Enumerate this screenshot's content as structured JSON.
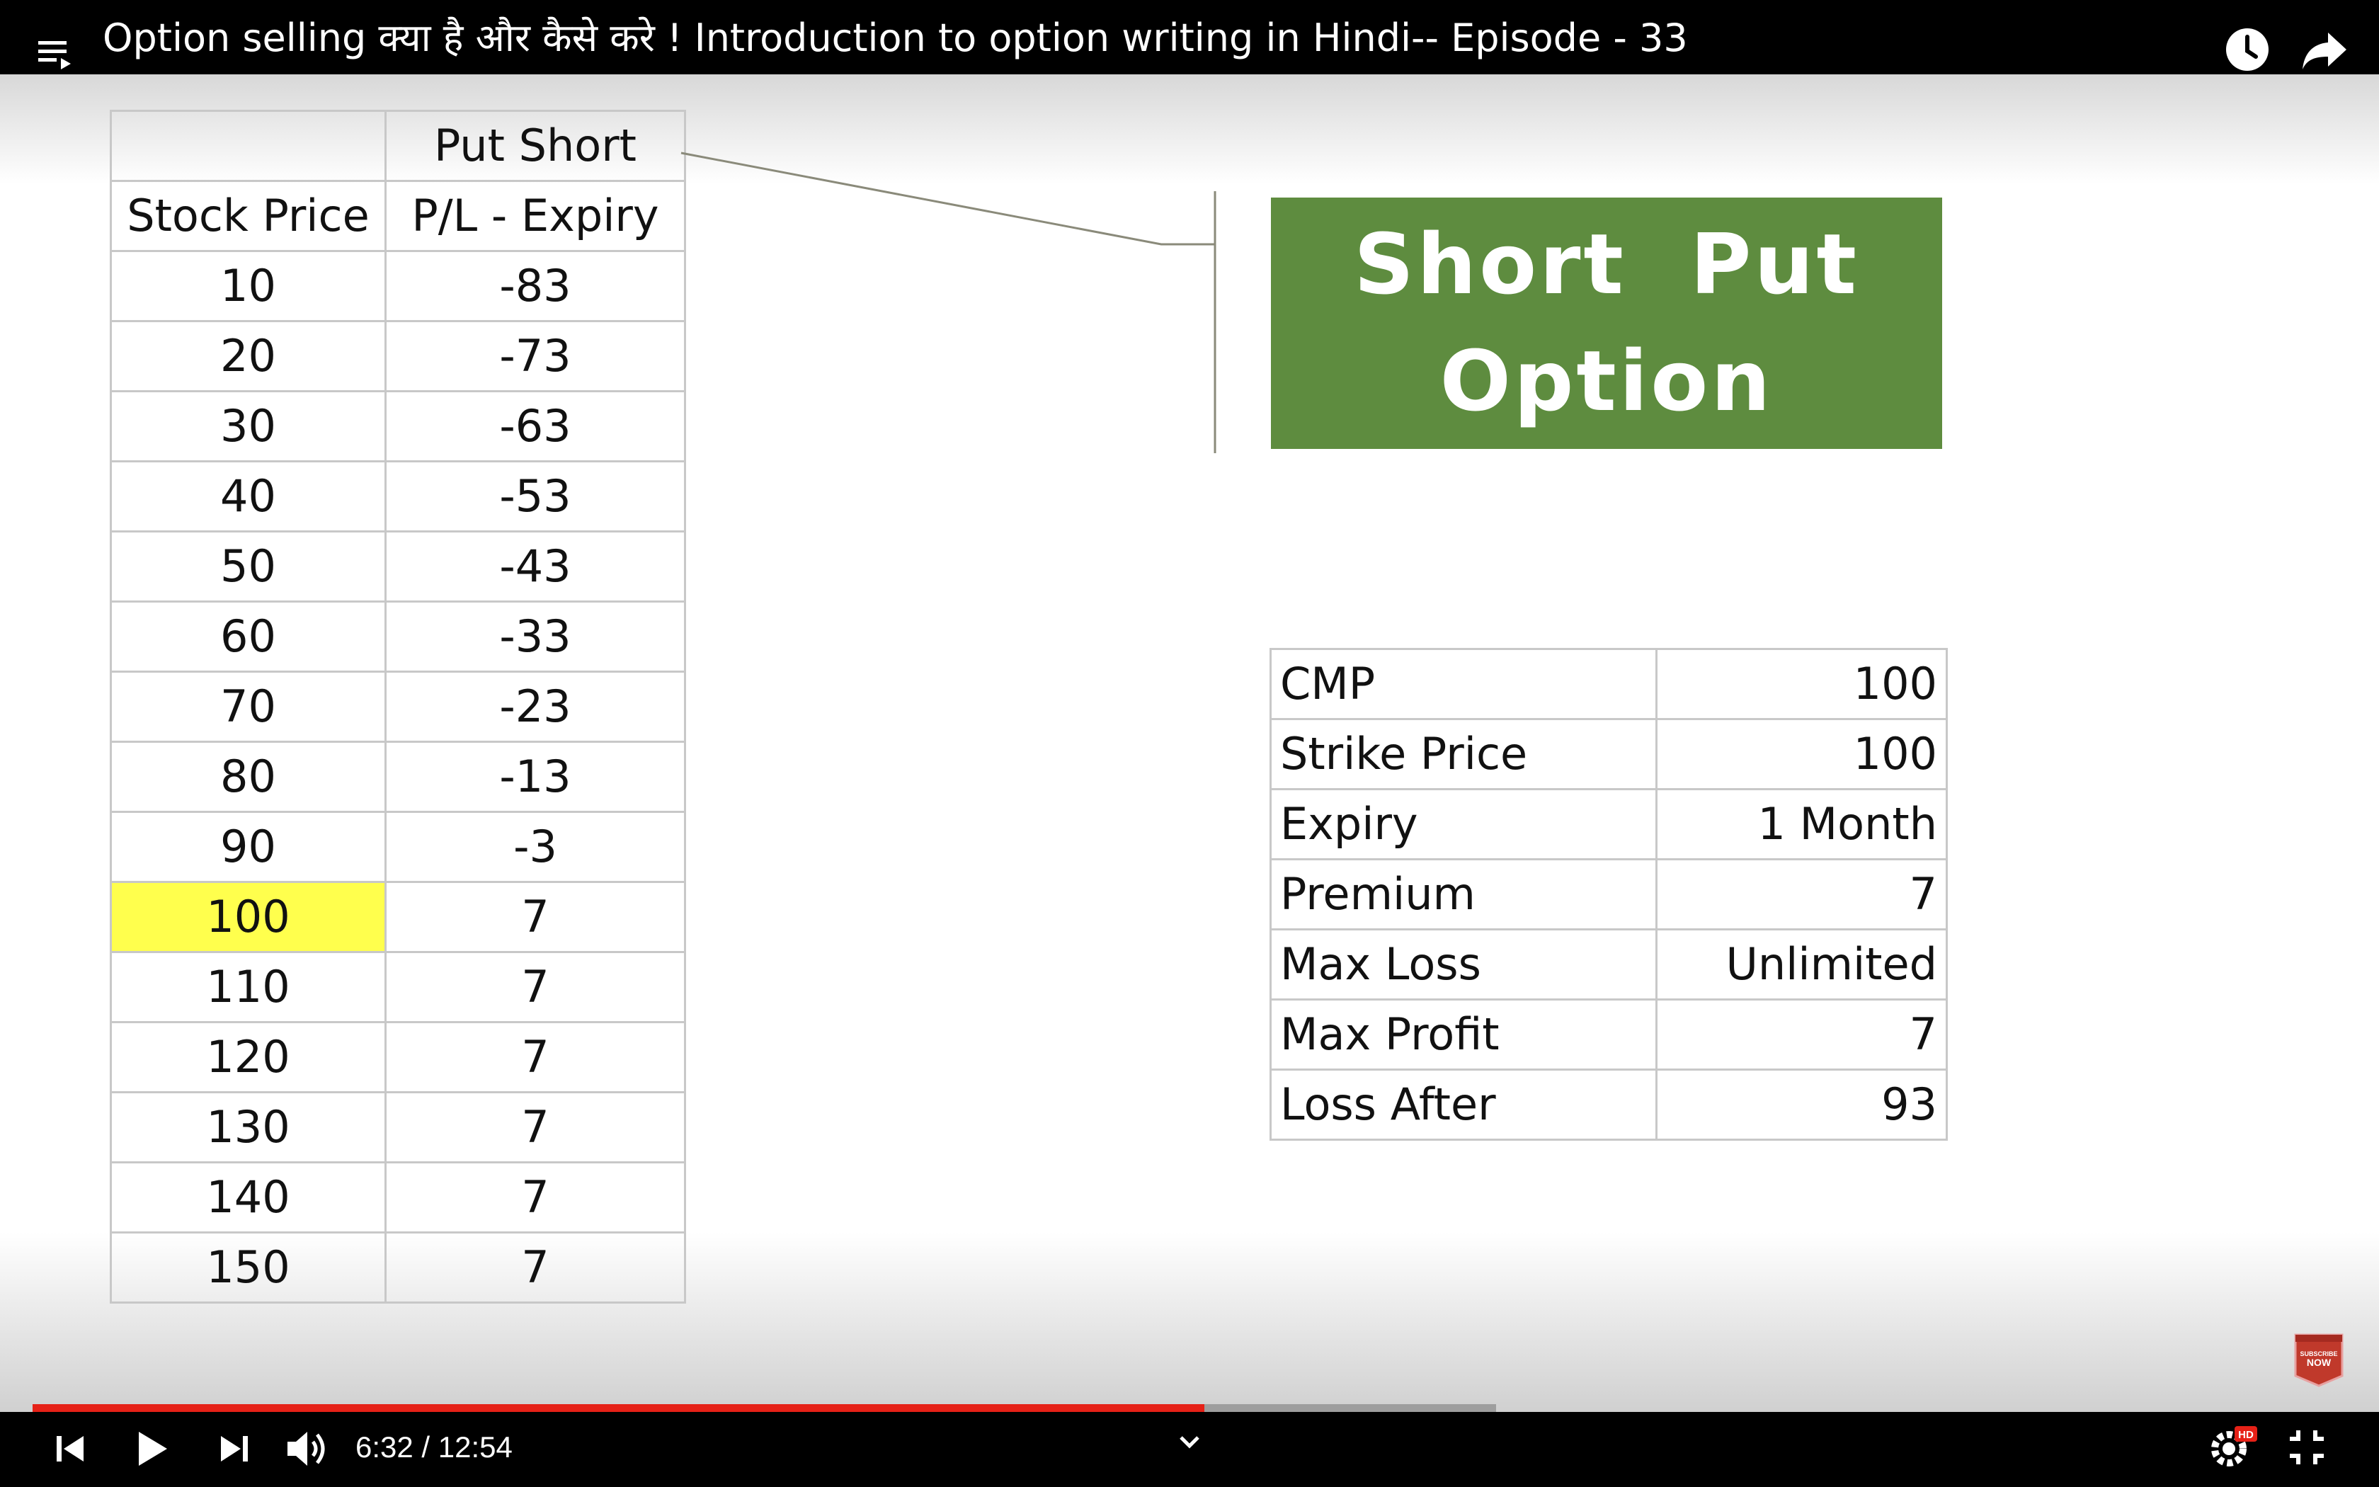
{
  "player": {
    "title": "Option selling क्या है और कैसे करे ! Introduction to option writing in Hindi-- Episode - 33",
    "time_display": "6:32 / 12:54",
    "progress": {
      "played_fraction": 0.506,
      "loaded_fraction": 0.632
    },
    "colors": {
      "bar": "#000000",
      "played": "#e62117",
      "buffer": "#9e9e9e"
    },
    "icons": [
      "playlist-icon",
      "watch-later-icon",
      "share-icon",
      "previous-icon",
      "play-icon",
      "next-icon",
      "volume-icon",
      "chevron-down-icon",
      "settings-icon",
      "exit-fullscreen-icon"
    ],
    "hd_badge": "HD",
    "subscribe_badge": "SUBSCRIBE NOW"
  },
  "slide": {
    "left_table": {
      "header_row1": [
        "",
        "Put Short"
      ],
      "header_row2": [
        "Stock Price",
        "P/L - Expiry"
      ],
      "rows": [
        [
          "10",
          "-83"
        ],
        [
          "20",
          "-73"
        ],
        [
          "30",
          "-63"
        ],
        [
          "40",
          "-53"
        ],
        [
          "50",
          "-43"
        ],
        [
          "60",
          "-33"
        ],
        [
          "70",
          "-23"
        ],
        [
          "80",
          "-13"
        ],
        [
          "90",
          "-3"
        ],
        [
          "100",
          "7"
        ],
        [
          "110",
          "7"
        ],
        [
          "120",
          "7"
        ],
        [
          "130",
          "7"
        ],
        [
          "140",
          "7"
        ],
        [
          "150",
          "7"
        ]
      ],
      "highlight_color": "#ffff4d"
    },
    "title_box": {
      "line1": "Short  Put",
      "line2": "Option",
      "color": "#5e8c3f"
    },
    "summary_table": {
      "rows": [
        [
          "CMP",
          "100"
        ],
        [
          "Strike Price",
          "100"
        ],
        [
          "Expiry",
          "1 Month"
        ],
        [
          "Premium",
          "7"
        ],
        [
          "Max Loss",
          "Unlimited"
        ],
        [
          "Max Profit",
          "7"
        ],
        [
          "Loss After",
          "93"
        ]
      ]
    }
  }
}
